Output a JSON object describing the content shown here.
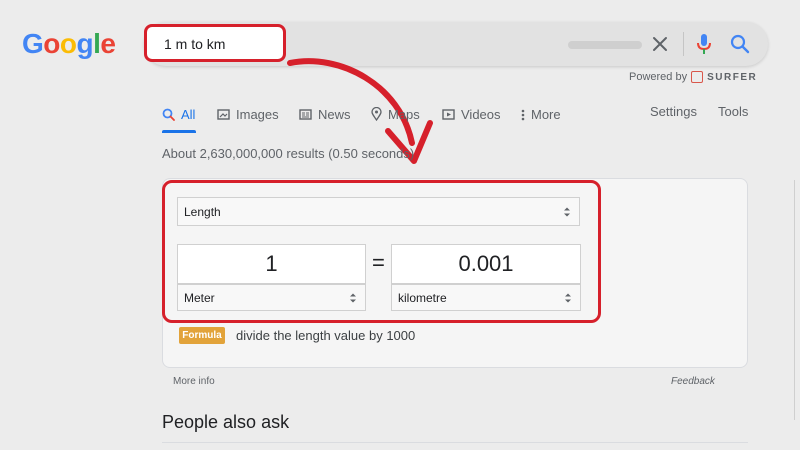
{
  "logo": {
    "letters": [
      {
        "ch": "G",
        "color": "#4285f4"
      },
      {
        "ch": "o",
        "color": "#ea4335"
      },
      {
        "ch": "o",
        "color": "#fbbc05"
      },
      {
        "ch": "g",
        "color": "#4285f4"
      },
      {
        "ch": "l",
        "color": "#34a853"
      },
      {
        "ch": "e",
        "color": "#ea4335"
      }
    ]
  },
  "search": {
    "query": "1 m to km",
    "icons": [
      "clear-icon",
      "mic-icon",
      "search-icon"
    ]
  },
  "powered_by": {
    "label": "Powered by",
    "brand": "SURFER"
  },
  "tabs": [
    {
      "label": "All",
      "icon": "search-icon",
      "active": true
    },
    {
      "label": "Images",
      "icon": "image-icon",
      "active": false
    },
    {
      "label": "News",
      "icon": "news-icon",
      "active": false
    },
    {
      "label": "Maps",
      "icon": "map-pin-icon",
      "active": false
    },
    {
      "label": "Videos",
      "icon": "video-icon",
      "active": false
    },
    {
      "label": "More",
      "icon": "more-vertical-icon",
      "active": false
    }
  ],
  "right_tabs": {
    "settings": "Settings",
    "tools": "Tools"
  },
  "result_stats": "About 2,630,000,000 results (0.50 seconds)",
  "converter": {
    "unit_type": "Length",
    "from_value": "1",
    "to_value": "0.001",
    "equals": "=",
    "from_unit": "Meter",
    "to_unit": "kilometre",
    "formula_label": "Formula",
    "formula_text": "divide the length value by 1000",
    "more_info": "More info",
    "feedback": "Feedback"
  },
  "people_also_ask": "People also ask",
  "colors": {
    "accent_blue": "#1a73e8",
    "highlight_red": "#d6202b",
    "formula_badge": "#e2a33a"
  }
}
